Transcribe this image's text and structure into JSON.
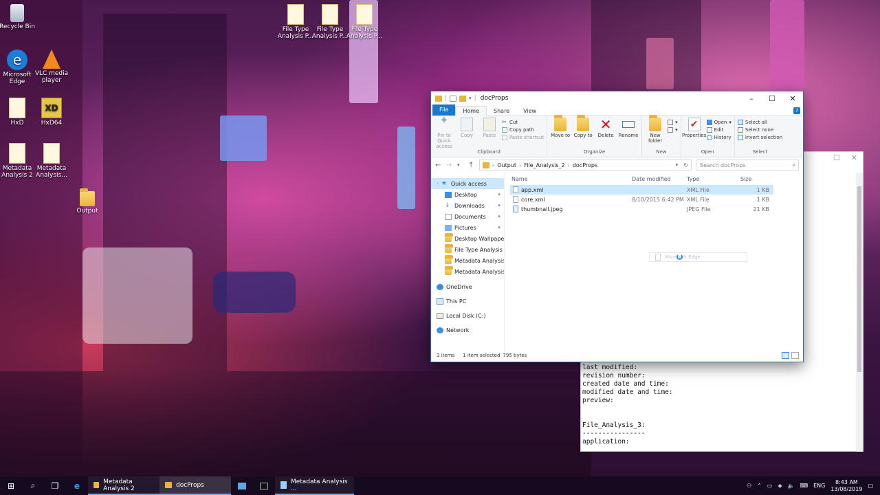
{
  "desktop": {
    "icons": [
      {
        "label": "Recycle Bin"
      },
      {
        "label": "Microsoft Edge"
      },
      {
        "label": "VLC media player"
      },
      {
        "label": "HxD"
      },
      {
        "label": "HxD64"
      },
      {
        "label": "Metadata Analysis 2"
      },
      {
        "label": "Metadata Analysis..."
      },
      {
        "label": "File Type Analysis P..."
      },
      {
        "label": "File Type Analysis P..."
      },
      {
        "label": "File Type Analysis P..."
      },
      {
        "label": "Output"
      }
    ]
  },
  "explorer": {
    "title": "docProps",
    "tabs": {
      "file": "File",
      "home": "Home",
      "share": "Share",
      "view": "View"
    },
    "ribbon": {
      "clipboard": {
        "label": "Clipboard",
        "pin": "Pin to Quick access",
        "copy": "Copy",
        "paste": "Paste",
        "cut": "Cut",
        "copy_path": "Copy path",
        "paste_shortcut": "Paste shortcut"
      },
      "organize": {
        "label": "Organize",
        "move_to": "Move to",
        "copy_to": "Copy to",
        "delete": "Delete",
        "rename": "Rename"
      },
      "new": {
        "label": "New",
        "new_folder": "New folder"
      },
      "open": {
        "label": "Open",
        "properties": "Properties",
        "open": "Open",
        "edit": "Edit",
        "history": "History"
      },
      "select": {
        "label": "Select",
        "select_all": "Select all",
        "select_none": "Select none",
        "invert": "Invert selection"
      }
    },
    "address": {
      "crumbs": [
        "Output",
        "File_Analysis_2",
        "docProps"
      ],
      "search_placeholder": "Search docProps"
    },
    "nav": {
      "quick_access": "Quick access",
      "items": [
        "Desktop",
        "Downloads",
        "Documents",
        "Pictures",
        "Desktop Wallpapers",
        "File Type Analysis P",
        "Metadata Analysis 2",
        "Metadata Analysis 2"
      ],
      "onedrive": "OneDrive",
      "this_pc": "This PC",
      "local_disk": "Local Disk (C:)",
      "network": "Network"
    },
    "columns": {
      "name": "Name",
      "date": "Date modified",
      "type": "Type",
      "size": "Size"
    },
    "files": [
      {
        "name": "app.xml",
        "date": "",
        "type": "XML File",
        "size": "1 KB"
      },
      {
        "name": "core.xml",
        "date": "8/10/2015 6:42 PM",
        "type": "XML File",
        "size": "1 KB"
      },
      {
        "name": "thumbnail.jpeg",
        "date": "",
        "type": "JPEG File",
        "size": "21 KB"
      }
    ],
    "drag_ghost": "Microsoft Edge",
    "status": {
      "count": "3 items",
      "selected": "1 item selected",
      "size": "795 bytes"
    }
  },
  "textwindow": {
    "lines": "last modified:\nrevision number:\ncreated date and time:\nmodified date and time:\npreview:\n\n\nFile_Analysis_3:\n----------------\napplication:"
  },
  "taskbar": {
    "apps": [
      {
        "label": "Metadata Analysis 2"
      },
      {
        "label": "docProps"
      },
      {
        "label": "Metadata Analysis ..."
      }
    ],
    "lang": "ENG",
    "time": "8:43 AM",
    "date": "13/08/2019"
  }
}
